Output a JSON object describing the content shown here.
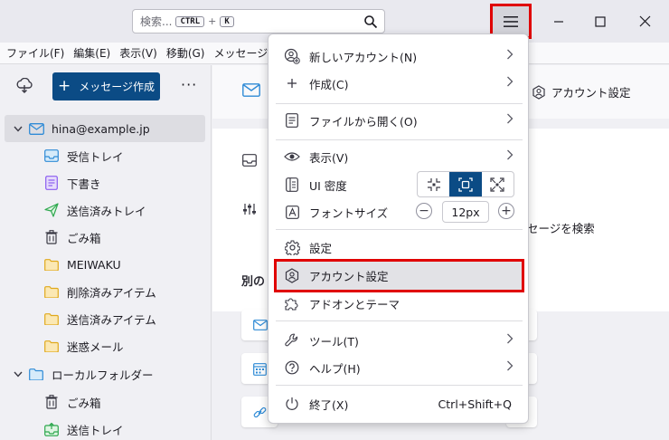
{
  "titlebar": {
    "search_placeholder": "検索...",
    "search_key1": "CTRL",
    "search_plus": "+",
    "search_key2": "K"
  },
  "menubar": [
    "ファイル(F)",
    "編集(E)",
    "表示(V)",
    "移動(G)",
    "メッセージ(M"
  ],
  "sidebar": {
    "compose_label": "メッセージ作成",
    "more_label": "···",
    "folders": [
      {
        "label": "hina@example.jp",
        "icon": "mail-account-icon"
      },
      {
        "label": "受信トレイ",
        "icon": "inbox-icon"
      },
      {
        "label": "下書き",
        "icon": "drafts-icon"
      },
      {
        "label": "送信済みトレイ",
        "icon": "sent-icon"
      },
      {
        "label": "ごみ箱",
        "icon": "trash-icon"
      },
      {
        "label": "MEIWAKU",
        "icon": "folder-icon"
      },
      {
        "label": "削除済みアイテム",
        "icon": "folder-icon"
      },
      {
        "label": "送信済みアイテム",
        "icon": "folder-icon"
      },
      {
        "label": "迷惑メール",
        "icon": "folder-icon"
      },
      {
        "label": "ローカルフォルダー",
        "icon": "local-folder-icon"
      },
      {
        "label": "ごみ箱",
        "icon": "trash-icon"
      },
      {
        "label": "送信トレイ",
        "icon": "outbox-icon"
      }
    ]
  },
  "main": {
    "account_settings_link": "アカウント設定",
    "search_messages": "セージを検索",
    "other_heading": "別の"
  },
  "app_menu": {
    "new_account": "新しいアカウント(N)",
    "create": "作成(C)",
    "open_file": "ファイルから開く(O)",
    "view": "表示(V)",
    "ui_density": "UI 密度",
    "font_size": "フォントサイズ",
    "font_size_value": "12px",
    "font_minus": "−",
    "font_plus": "+",
    "settings": "設定",
    "account_settings": "アカウント設定",
    "addons_themes": "アドオンとテーマ",
    "tools": "ツール(T)",
    "help": "ヘルプ(H)",
    "quit": "終了(X)",
    "quit_shortcut": "Ctrl+Shift+Q"
  },
  "colors": {
    "accent": "#0b4b85",
    "highlight_border": "#e00000",
    "folder_yellow": "#f0c23b",
    "blue_icon": "#2f8bd6"
  }
}
